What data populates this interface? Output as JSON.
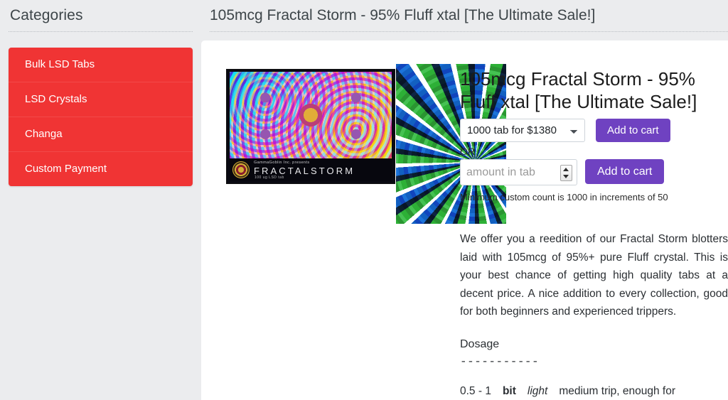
{
  "sidebar": {
    "heading": "Categories",
    "items": [
      {
        "label": "Bulk LSD Tabs"
      },
      {
        "label": "LSD Crystals"
      },
      {
        "label": "Changa"
      },
      {
        "label": "Custom Payment"
      }
    ]
  },
  "header": {
    "title": "105mcg Fractal Storm - 95% Fluff xtal [The Ultimate Sale!]"
  },
  "product": {
    "title": "105mcg Fractal Storm - 95% Fluff xtal [The Ultimate Sale!]",
    "blotter_image": {
      "brand_line": "GammaGoblin Inc. presents",
      "title": "FRACTALSTORM",
      "subtitle": "100 ug LSD tab",
      "logo_icon": "mandala-logo-icon"
    },
    "spiral_image": {
      "alt": "green and blue psychedelic spiral"
    }
  },
  "purchase": {
    "variant_selected": "1000 tab for $1380",
    "variant_options": [
      "1000 tab for $1380"
    ],
    "add_to_cart_label": "Add to cart",
    "or_label": "OR",
    "custom_amount_placeholder": "amount in tab",
    "custom_amount_value": "",
    "add_to_cart_custom_label": "Add to cart",
    "minimum_note": "Minimum custom count is 1000 in increments of 50",
    "select_icon": "chevron-down-icon",
    "stepper_icon": "spinner-arrows-icon",
    "button_color": "#6f42c1"
  },
  "description": {
    "paragraph": "We offer you a reedition of our Fractal Storm blotters laid with 105mcg of 95%+ pure Fluff crystal. This is your best chance of getting high quality tabs at a decent price. A nice addition to every collection, good for both beginners and experienced trippers.",
    "dosage_heading": "Dosage",
    "dosage_rule": "-----------",
    "dosage_first": {
      "range": "0.5 - 1",
      "unit": "bit",
      "intensity": "light",
      "rest": "medium trip, enough for"
    }
  },
  "colors": {
    "page_background": "#ebecee",
    "card_background": "#ffffff",
    "category_red": "#f03434",
    "accent_purple": "#6f42c1",
    "heading_text": "#3d4549"
  }
}
